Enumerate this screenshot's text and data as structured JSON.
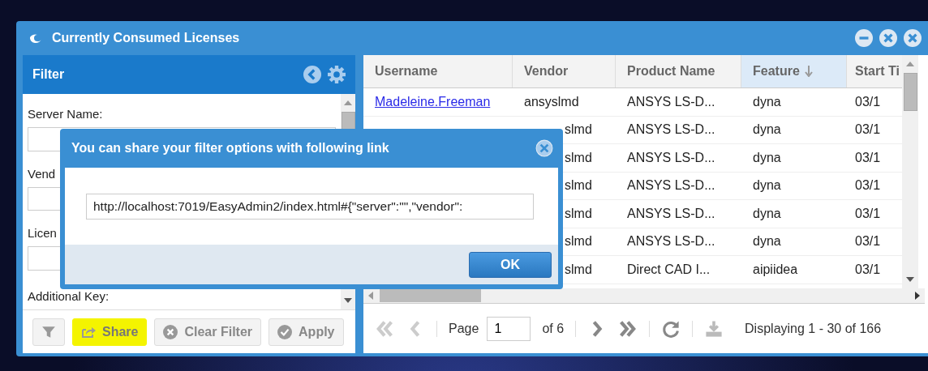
{
  "window": {
    "title": "Currently Consumed Licenses"
  },
  "filter": {
    "title": "Filter",
    "fields": [
      {
        "label": "Server Name:"
      },
      {
        "label": "Vend"
      },
      {
        "label": "Licen"
      }
    ],
    "last_label": "Additional Key:",
    "buttons": [
      {
        "kind": "funnel",
        "highlighted": false
      },
      {
        "kind": "share",
        "label": "Share",
        "highlighted": true
      },
      {
        "kind": "clear",
        "label": "Clear Filter",
        "highlighted": false
      },
      {
        "kind": "apply",
        "label": "Apply",
        "highlighted": false
      }
    ]
  },
  "table": {
    "columns": [
      {
        "label": "Username",
        "sorted": false
      },
      {
        "label": "Vendor",
        "sorted": false
      },
      {
        "label": "Product Name",
        "sorted": false
      },
      {
        "label": "Feature",
        "sorted": true
      },
      {
        "label": "Start Ti",
        "sorted": false
      }
    ],
    "rows": [
      {
        "covered": false,
        "cells": [
          "Madeleine.Freeman",
          "ansyslmd",
          "ANSYS LS-D...",
          "dyna",
          "03/1"
        ]
      },
      {
        "covered": true,
        "cells": [
          "slmd",
          "ANSYS LS-D...",
          "dyna",
          "03/1"
        ]
      },
      {
        "covered": true,
        "cells": [
          "slmd",
          "ANSYS LS-D...",
          "dyna",
          "03/1"
        ]
      },
      {
        "covered": true,
        "cells": [
          "slmd",
          "ANSYS LS-D...",
          "dyna",
          "03/1"
        ]
      },
      {
        "covered": true,
        "cells": [
          "slmd",
          "ANSYS LS-D...",
          "dyna",
          "03/1"
        ]
      },
      {
        "covered": true,
        "cells": [
          "slmd",
          "ANSYS LS-D...",
          "dyna",
          "03/1"
        ]
      },
      {
        "covered": true,
        "cells": [
          "slmd",
          "Direct CAD I...",
          "aipiidea",
          "03/1"
        ]
      }
    ]
  },
  "pager": {
    "page_label": "Page",
    "page": "1",
    "of": "of 6",
    "display": "Displaying 1 - 30 of 166"
  },
  "dialog": {
    "title": "You can share your filter options with following link",
    "link": "http://localhost:7019/EasyAdmin2/index.html#{\"server\":\"\",\"vendor\":",
    "ok": "OK"
  }
}
